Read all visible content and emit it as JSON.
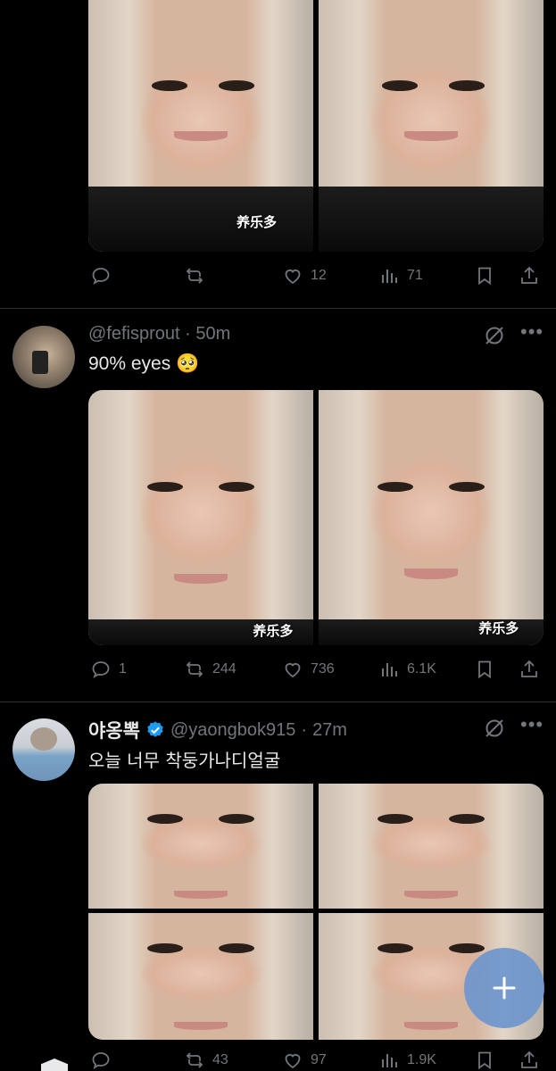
{
  "tweets": [
    {
      "watermarks": [
        "",
        "养乐多"
      ],
      "actions": {
        "replies": "",
        "reposts": "",
        "likes": "12",
        "views": "71"
      }
    },
    {
      "handle": "@fefisprout",
      "time": "50m",
      "text": "90% eyes 🥺",
      "watermarks": [
        "养乐多",
        "养乐多"
      ],
      "actions": {
        "replies": "1",
        "reposts": "244",
        "likes": "736",
        "views": "6.1K"
      }
    },
    {
      "display_name": "야옹뽁",
      "verified": true,
      "handle": "@yaongbok915",
      "time": "27m",
      "text": "오늘 너무 착둥가나디얼굴",
      "actions": {
        "replies": "",
        "reposts": "43",
        "likes": "97",
        "views": "1.9K"
      }
    }
  ],
  "fab": {
    "icon": "plus-icon"
  },
  "colors": {
    "background": "#000000",
    "muted": "#71767b",
    "verified": "#1d9bf0",
    "fab": "#6e96cd"
  }
}
